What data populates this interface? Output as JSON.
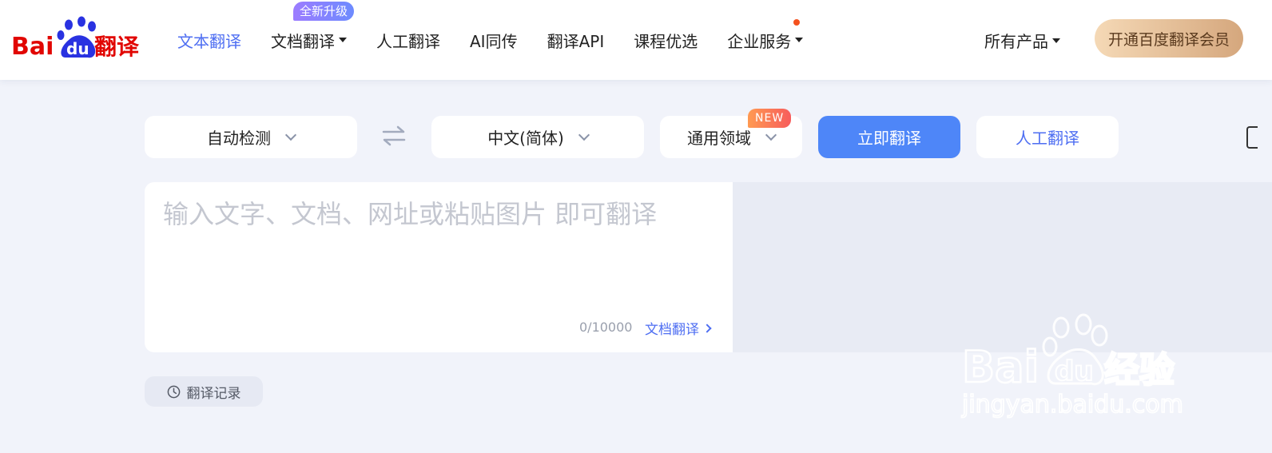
{
  "logo": {
    "text": "Bai",
    "du": "du",
    "suffix": "翻译"
  },
  "nav": {
    "items": [
      {
        "label": "文本翻译"
      },
      {
        "label": "文档翻译"
      },
      {
        "label": "人工翻译"
      },
      {
        "label": "AI同传"
      },
      {
        "label": "翻译API"
      },
      {
        "label": "课程优选"
      },
      {
        "label": "企业服务"
      }
    ],
    "upgrade_badge": "全新升级",
    "all_products": "所有产品",
    "vip_button": "开通百度翻译会员"
  },
  "toolbar": {
    "source_lang": "自动检测",
    "target_lang": "中文(简体)",
    "domain": "通用领域",
    "new_badge": "NEW",
    "translate_button": "立即翻译",
    "human_button": "人工翻译"
  },
  "input": {
    "placeholder": "输入文字、文档、网址或粘贴图片 即可翻译",
    "value": "",
    "counter": "0/10000",
    "doc_link": "文档翻译"
  },
  "history": {
    "label": "翻译记录"
  },
  "watermark": {
    "brand": "Bai",
    "du": "du",
    "suffix": "经验",
    "url": "jingyan.baidu.com"
  },
  "colors": {
    "accent": "#4e6ef2",
    "logo_red": "#e10602",
    "logo_blue": "#2932e1"
  }
}
